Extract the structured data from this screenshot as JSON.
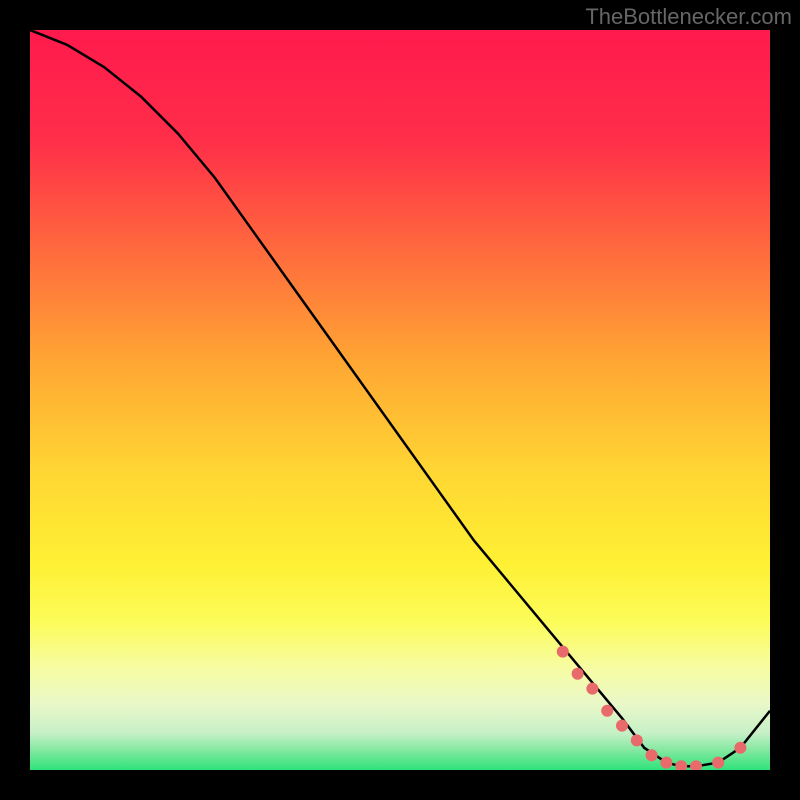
{
  "attribution": "TheBottlenecker.com",
  "chart_data": {
    "type": "line",
    "title": "",
    "xlabel": "",
    "ylabel": "",
    "xlim": [
      0,
      100
    ],
    "ylim": [
      0,
      100
    ],
    "series": [
      {
        "name": "bottleneck-curve",
        "x": [
          0,
          5,
          10,
          15,
          20,
          25,
          30,
          35,
          40,
          45,
          50,
          55,
          60,
          65,
          70,
          75,
          80,
          83,
          86,
          88,
          90,
          93,
          96,
          100
        ],
        "values": [
          100,
          98,
          95,
          91,
          86,
          80,
          73,
          66,
          59,
          52,
          45,
          38,
          31,
          25,
          19,
          13,
          7,
          3,
          1,
          0.5,
          0.5,
          1,
          3,
          8
        ]
      }
    ],
    "markers": {
      "name": "highlight-points",
      "x": [
        72,
        74,
        76,
        78,
        80,
        82,
        84,
        86,
        88,
        90,
        93,
        96
      ],
      "values": [
        16,
        13,
        11,
        8,
        6,
        4,
        2,
        1,
        0.5,
        0.5,
        1,
        3
      ]
    },
    "gradient_stops": [
      {
        "offset": 0.0,
        "color": "#ff1a4d"
      },
      {
        "offset": 0.15,
        "color": "#ff2e49"
      },
      {
        "offset": 0.3,
        "color": "#ff6b3d"
      },
      {
        "offset": 0.45,
        "color": "#ffa733"
      },
      {
        "offset": 0.6,
        "color": "#ffd733"
      },
      {
        "offset": 0.72,
        "color": "#fff033"
      },
      {
        "offset": 0.8,
        "color": "#fcfc5a"
      },
      {
        "offset": 0.86,
        "color": "#f7fca0"
      },
      {
        "offset": 0.91,
        "color": "#eaf8c8"
      },
      {
        "offset": 0.95,
        "color": "#c7f0c7"
      },
      {
        "offset": 0.975,
        "color": "#7de89e"
      },
      {
        "offset": 1.0,
        "color": "#2fe37a"
      }
    ]
  }
}
